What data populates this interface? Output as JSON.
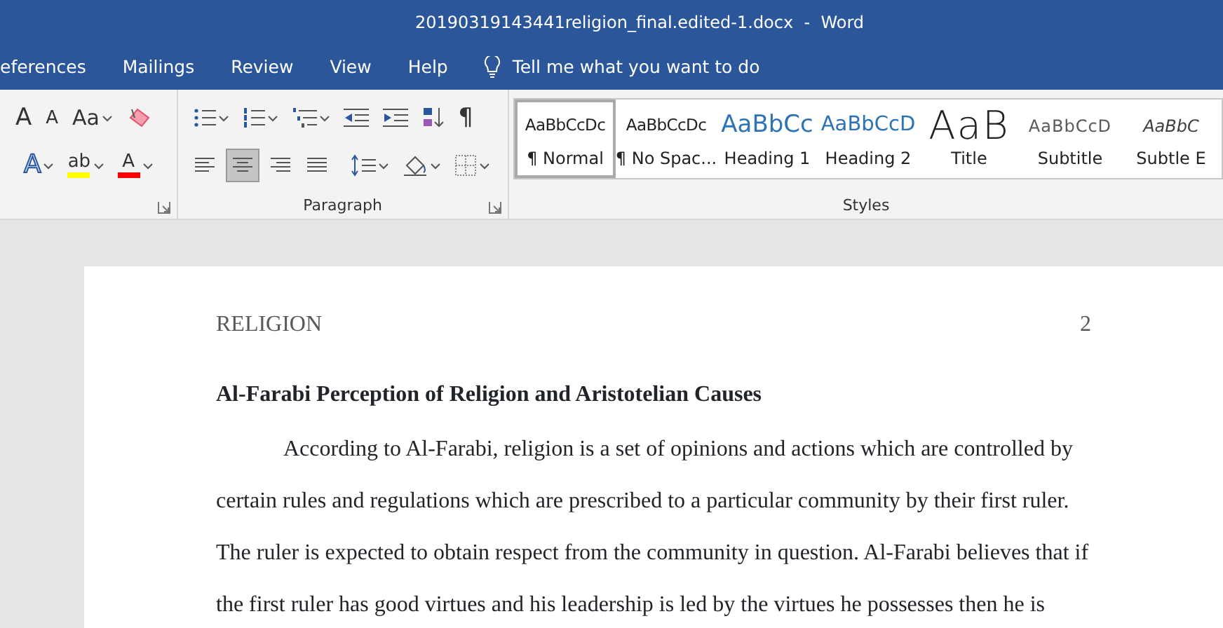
{
  "window": {
    "title": "20190319143441religion_final.edited-1.docx  -  Word"
  },
  "ribbon_tabs": [
    "eferences",
    "Mailings",
    "Review",
    "View",
    "Help"
  ],
  "tell_me": "Tell me what you want to do",
  "font_group": {
    "row1": [
      {
        "kind": "grow",
        "glyph": "A",
        "dropdown": false
      },
      {
        "kind": "shrink",
        "glyph": "A",
        "dropdown": false
      },
      {
        "kind": "case",
        "glyph": "Aa",
        "dropdown": true
      },
      {
        "kind": "clear",
        "dropdown": false
      }
    ],
    "row2": [
      {
        "kind": "effects",
        "glyph": "A",
        "dropdown": true
      },
      {
        "kind": "highlight",
        "glyph": "ab",
        "dropdown": true,
        "color": "#ffff00"
      },
      {
        "kind": "font_color",
        "glyph": "A",
        "dropdown": true,
        "color": "#ff0000"
      }
    ]
  },
  "paragraph_group": {
    "label": "Paragraph",
    "row1": [
      {
        "kind": "bullets",
        "dropdown": true
      },
      {
        "kind": "numbering",
        "dropdown": true
      },
      {
        "kind": "multilevel",
        "dropdown": true
      },
      {
        "kind": "outdent",
        "dropdown": false
      },
      {
        "kind": "indent",
        "dropdown": false
      },
      {
        "kind": "sort",
        "dropdown": false
      },
      {
        "kind": "marks",
        "glyph": "¶",
        "dropdown": false
      }
    ],
    "alignment": [
      {
        "kind": "left",
        "selected": false
      },
      {
        "kind": "center",
        "selected": true
      },
      {
        "kind": "right",
        "selected": false
      },
      {
        "kind": "justify",
        "selected": false
      }
    ],
    "row2": [
      {
        "kind": "spacing",
        "dropdown": true
      },
      {
        "kind": "shading",
        "dropdown": true
      },
      {
        "kind": "borders",
        "dropdown": true
      }
    ]
  },
  "styles_group": {
    "label": "Styles",
    "items": [
      {
        "kind": "normal",
        "preview": "AaBbCcDc",
        "name": "¶ Normal",
        "selected": true
      },
      {
        "kind": "normal",
        "preview": "AaBbCcDc",
        "name": "¶ No Spac...",
        "selected": false
      },
      {
        "kind": "heading1",
        "preview": "AaBbCc",
        "name": "Heading 1",
        "selected": false
      },
      {
        "kind": "heading2",
        "preview": "AaBbCcD",
        "name": "Heading 2",
        "selected": false
      },
      {
        "kind": "title",
        "preview": "AaB",
        "name": "Title",
        "selected": false
      },
      {
        "kind": "subtitle",
        "preview": "AaBbCcD",
        "name": "Subtitle",
        "selected": false
      },
      {
        "kind": "emphasis",
        "preview": "AaBbC",
        "name": "Subtle E",
        "selected": false
      }
    ]
  },
  "document": {
    "header": "RELIGION",
    "page_number": "2",
    "heading": "Al-Farabi Perception of Religion and Aristotelian Causes",
    "paragraph": "According to Al-Farabi, religion is a set of opinions and actions which are controlled by certain rules and regulations which are prescribed to a particular community by their first ruler. The ruler is expected to obtain respect from the community in question. Al-Farabi believes that if the first ruler has good virtues and his leadership is led by the virtues he possesses then he is"
  }
}
